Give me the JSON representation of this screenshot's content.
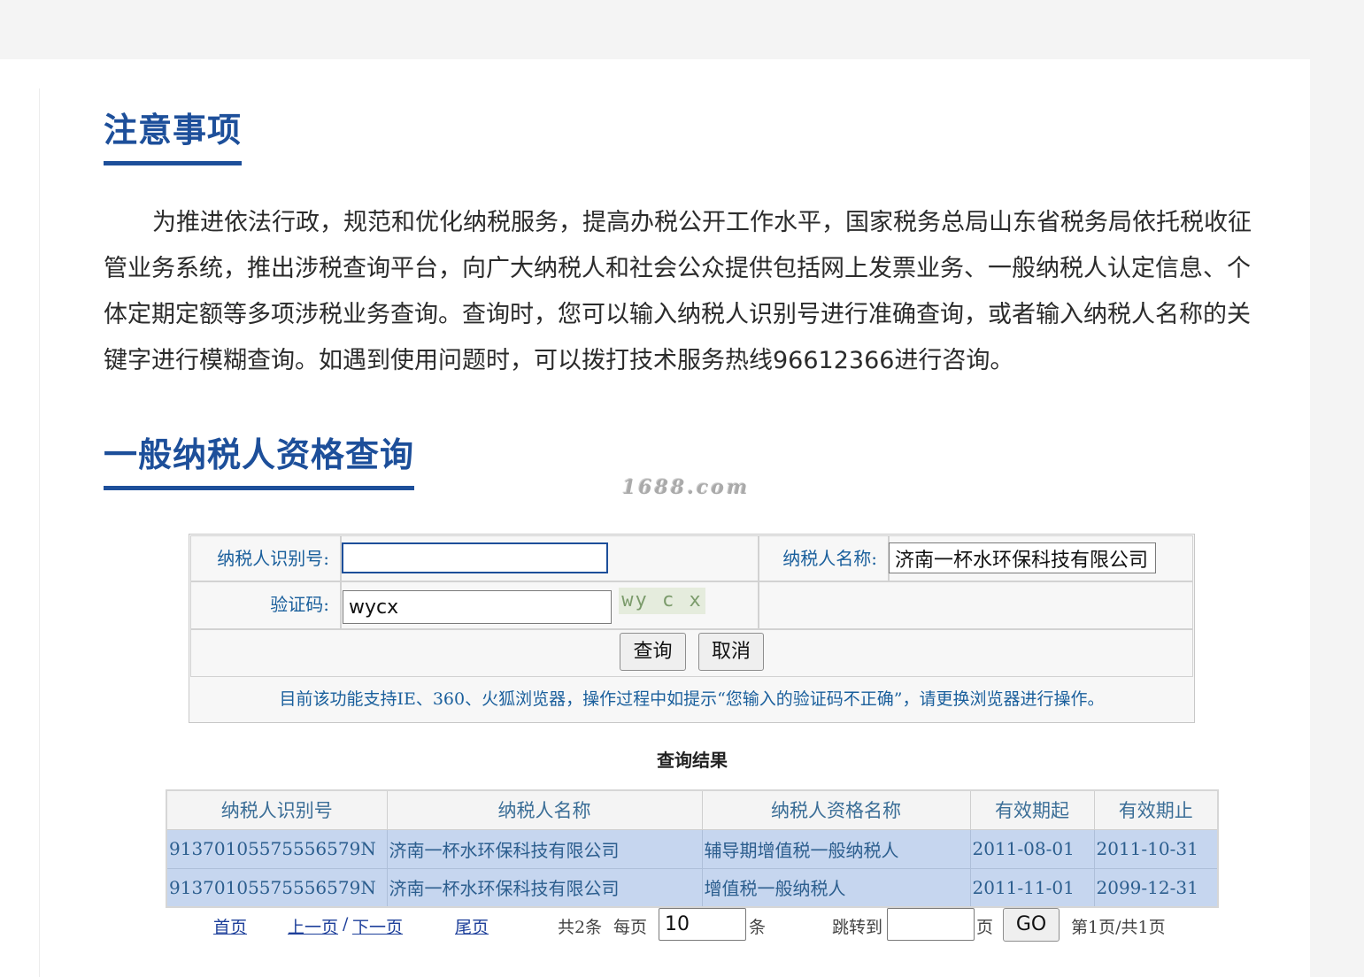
{
  "notice": {
    "title": "注意事项",
    "body": "为推进依法行政，规范和优化纳税服务，提高办税公开工作水平，国家税务总局山东省税务局依托税收征管业务系统，推出涉税查询平台，向广大纳税人和社会公众提供包括网上发票业务、一般纳税人认定信息、个体定期定额等多项涉税业务查询。查询时，您可以输入纳税人识别号进行准确查询，或者输入纳税人名称的关键字进行模糊查询。如遇到使用问题时，可以拨打技术服务热线96612366进行咨询。"
  },
  "query": {
    "title": "一般纳税人资格查询",
    "watermark": "1688.com",
    "taxpayer_id_label": "纳税人识别号:",
    "taxpayer_id_value": "",
    "taxpayer_name_label": "纳税人名称:",
    "taxpayer_name_value": "济南一杯水环保科技有限公司",
    "captcha_label": "验证码:",
    "captcha_value": "wycx",
    "captcha_image_text": "wy c x",
    "search_button": "查询",
    "cancel_button": "取消",
    "hint": "目前该功能支持IE、360、火狐浏览器，操作过程中如提示“您输入的验证码不正确”，请更换浏览器进行操作。"
  },
  "results": {
    "title": "查询结果",
    "columns": [
      "纳税人识别号",
      "纳税人名称",
      "纳税人资格名称",
      "有效期起",
      "有效期止"
    ],
    "rows": [
      [
        "91370105575556579N",
        "济南一杯水环保科技有限公司",
        "辅导期增值税一般纳税人",
        "2011-08-01",
        "2011-10-31"
      ],
      [
        "91370105575556579N",
        "济南一杯水环保科技有限公司",
        "增值税一般纳税人",
        "2011-11-01",
        "2099-12-31"
      ]
    ]
  },
  "pager": {
    "first": "首页",
    "prev": "上一页",
    "sep": "/",
    "next": "下一页",
    "last": "尾页",
    "total": "共2条",
    "per_page_label": "每页",
    "per_page_value": "10",
    "per_page_unit": "条",
    "jump_label": "跳转到",
    "jump_value": "",
    "page_unit": "页",
    "go_button": "GO",
    "page_status": "第1页/共1页"
  }
}
